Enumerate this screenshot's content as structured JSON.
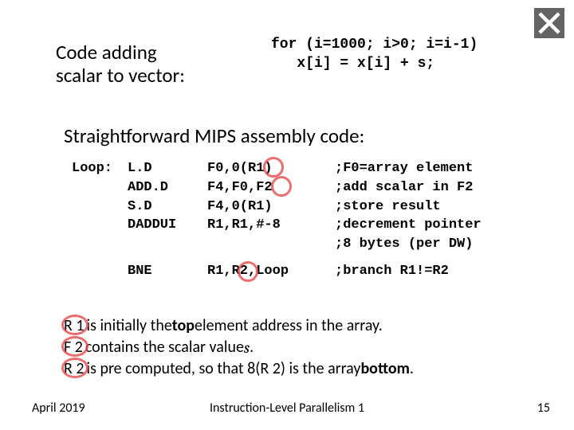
{
  "logo_name": "technion-logo",
  "heading": {
    "line1": "Code adding",
    "line2": "scalar to vector:"
  },
  "c_code": {
    "line1": "for (i=1000; i>0; i=i-1)",
    "line2": "   x[i] = x[i] + s;"
  },
  "subheading": "Straightforward MIPS assembly code:",
  "asm": [
    {
      "label": "Loop:",
      "op": "L.D",
      "args": "F0,0(R1)",
      "comment": ";F0=array element"
    },
    {
      "label": "",
      "op": "ADD.D",
      "args": "F4,F0,F2",
      "comment": ";add scalar in F2"
    },
    {
      "label": "",
      "op": "S.D",
      "args": "F4,0(R1)",
      "comment": ";store result"
    },
    {
      "label": "",
      "op": "DADDUI",
      "args": "R1,R1,#-8",
      "comment": ";decrement pointer"
    },
    {
      "label": "",
      "op": "",
      "args": "",
      "comment": ";8 bytes (per DW)"
    },
    {
      "label": "",
      "op": "BNE",
      "args": "R1,R2,Loop",
      "comment": ";branch R1!=R2"
    }
  ],
  "notes": {
    "n1_a": "R 1",
    "n1_b": " is initially the ",
    "n1_c": "top",
    "n1_d": " element address in the array.",
    "n2_a": "F 2",
    "n2_b": " contains the scalar value ",
    "n2_c": "s",
    "n2_d": ".",
    "n3_a": "R 2",
    "n3_b": " is pre computed, so that 8(R 2) is the array ",
    "n3_c": "bottom",
    "n3_d": "."
  },
  "footer": {
    "date": "April 2019",
    "title": "Instruction-Level Parallelism 1",
    "page": "15"
  }
}
